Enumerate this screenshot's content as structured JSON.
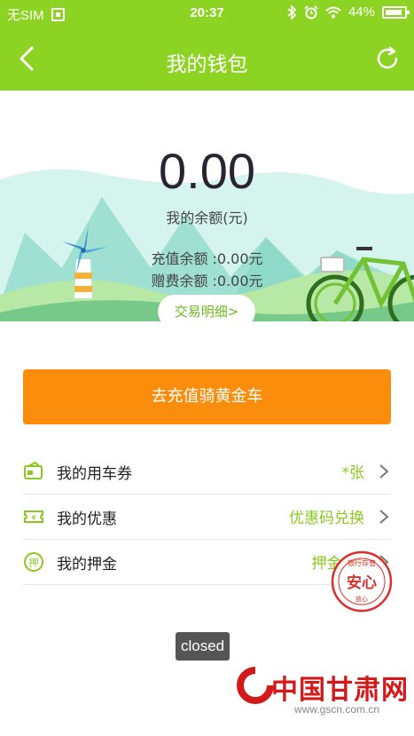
{
  "status_bar": {
    "carrier": "无SIM",
    "time": "20:37",
    "battery": "44%",
    "icons": [
      "sim-icon",
      "bluetooth-icon",
      "alarm-icon",
      "wifi-icon",
      "battery-icon"
    ]
  },
  "nav": {
    "title": "我的钱包",
    "back_icon": "chevron-left-icon",
    "refresh_icon": "refresh-icon"
  },
  "balance": {
    "amount": "0.00",
    "label": "我的余额(元)",
    "recharge_balance": "充值余额 :0.00元",
    "gift_balance": "赠费余额 :0.00元",
    "transactions_button": "交易明细>"
  },
  "recharge_button": "去充值骑黄金车",
  "menu": [
    {
      "label": "我的用车券",
      "value": "*张",
      "icon": "ticket-icon"
    },
    {
      "label": "我的优惠",
      "value": "优惠码兑换",
      "icon": "coupon-icon"
    },
    {
      "label": "我的押金",
      "value": "押金*元",
      "icon": "deposit-icon"
    }
  ],
  "stamp": {
    "text": "安心",
    "ring_text": "银行存管",
    "bottom_text": "放心"
  },
  "toast": "closed",
  "watermark": {
    "logo": "中国甘肃网",
    "url": "www.gscn.com.cn"
  },
  "colors": {
    "brand_green": "#8cd323",
    "accent_orange": "#fb8d0d",
    "value_green": "#8cc820",
    "stamp_red": "#d9302a"
  }
}
